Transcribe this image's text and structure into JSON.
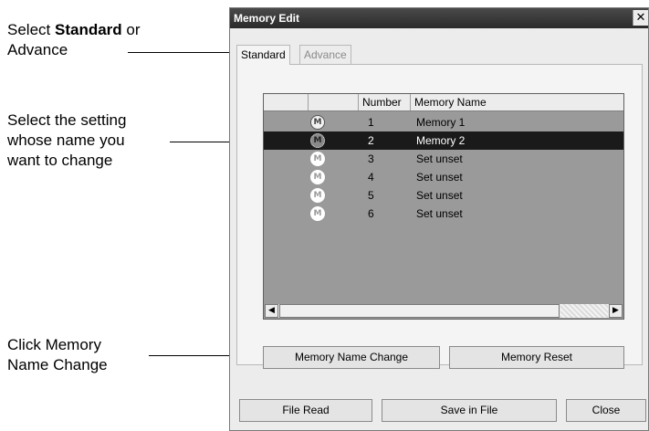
{
  "callouts": [
    {
      "pre": "Select ",
      "bold": "Standard",
      "post": " or",
      "line2_bold": "Advance"
    },
    {
      "line1": "Select the setting",
      "line2": "whose name you",
      "line3": "want to change"
    },
    {
      "pre": "Click ",
      "bold": "Memory",
      "line2_bold": "Name Change"
    }
  ],
  "window": {
    "title": "Memory Edit",
    "close_glyph": "✕"
  },
  "tabs": [
    {
      "label": "Standard",
      "active": true
    },
    {
      "label": "Advance",
      "active": false
    }
  ],
  "list": {
    "headers": [
      "",
      "",
      "Number",
      "Memory Name"
    ],
    "icon_glyph": "M",
    "rows": [
      {
        "number": "1",
        "name": "Memory 1",
        "selected": false,
        "set": true
      },
      {
        "number": "2",
        "name": "Memory 2",
        "selected": true,
        "set": true
      },
      {
        "number": "3",
        "name": "Set unset",
        "selected": false,
        "set": false
      },
      {
        "number": "4",
        "name": "Set unset",
        "selected": false,
        "set": false
      },
      {
        "number": "5",
        "name": "Set unset",
        "selected": false,
        "set": false
      },
      {
        "number": "6",
        "name": "Set unset",
        "selected": false,
        "set": false
      }
    ],
    "scroll_left_glyph": "◀",
    "scroll_right_glyph": "▶"
  },
  "buttons": {
    "memory_name_change": "Memory Name Change",
    "memory_reset": "Memory Reset",
    "file_read": "File Read",
    "save_in_file": "Save in File",
    "close": "Close"
  }
}
